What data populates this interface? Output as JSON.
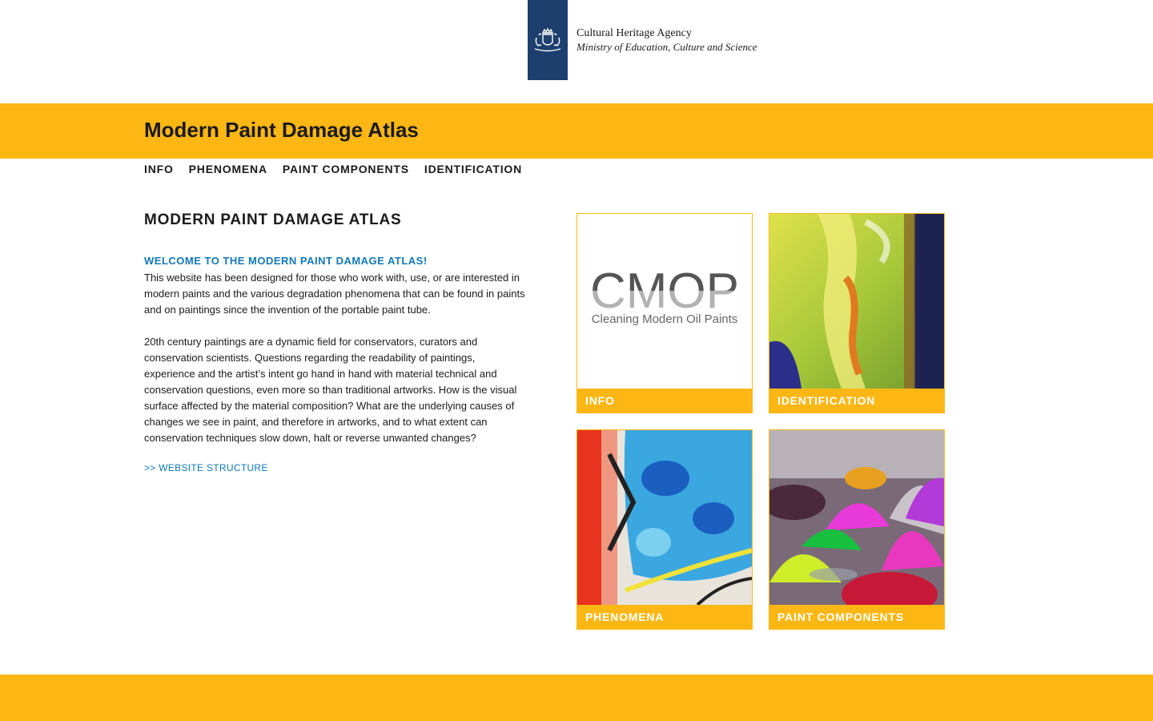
{
  "agency": {
    "name": "Cultural Heritage Agency",
    "ministry": "Ministry of Education, Culture and Science"
  },
  "site_title": "Modern Paint Damage Atlas",
  "nav": {
    "items": [
      {
        "label": "INFO"
      },
      {
        "label": "PHENOMENA"
      },
      {
        "label": "PAINT COMPONENTS"
      },
      {
        "label": "IDENTIFICATION"
      }
    ]
  },
  "main": {
    "title": "MODERN PAINT DAMAGE ATLAS",
    "welcome": "WELCOME TO THE MODERN PAINT DAMAGE ATLAS!",
    "para1": "This website has been designed for those who work with, use, or are interested in modern paints and the various degradation phenomena that can be found in paints and on paintings since the invention of the portable paint tube.",
    "para2": "20th century paintings are a dynamic field for conservators, curators and conservation scientists. Questions regarding the readability of paintings, experience and the artist’s intent go hand in hand with material technical and conservation questions, even more so than traditional artworks. How is the visual surface affected by the material composition? What are the underlying causes of changes we see in paint, and therefore in artworks, and to what extent can conservation techniques slow down, halt or reverse unwanted changes?",
    "structure_link": ">> WEBSITE STRUCTURE"
  },
  "tiles": [
    {
      "label": "INFO",
      "logo_text": "CMOP",
      "logo_subtext": "Cleaning Modern Oil Paints"
    },
    {
      "label": "IDENTIFICATION"
    },
    {
      "label": "PHENOMENA"
    },
    {
      "label": "PAINT COMPONENTS"
    }
  ],
  "colors": {
    "brand_yellow": "#fdb714",
    "agency_blue": "#1d3f6e",
    "link_blue": "#1278b9"
  }
}
